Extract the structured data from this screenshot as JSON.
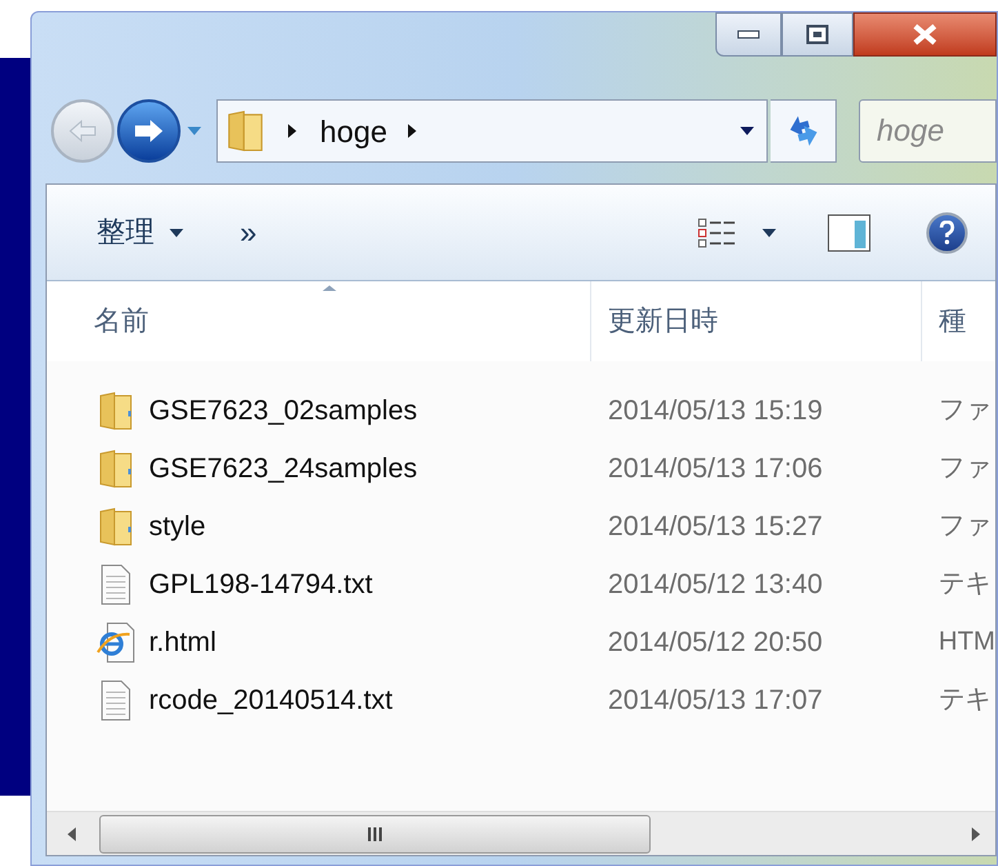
{
  "address_bar": {
    "crumbs": [
      "hoge"
    ]
  },
  "search": {
    "placeholder": "hoge"
  },
  "toolbar": {
    "organize": "整理",
    "more": "»"
  },
  "columns": [
    "名前",
    "更新日時",
    "種"
  ],
  "rows": [
    {
      "kind": "folder",
      "name": "GSE7623_02samples",
      "modified": "2014/05/13 15:19",
      "type": "ファ"
    },
    {
      "kind": "folder",
      "name": "GSE7623_24samples",
      "modified": "2014/05/13 17:06",
      "type": "ファ"
    },
    {
      "kind": "folder",
      "name": "style",
      "modified": "2014/05/13 15:27",
      "type": "ファ"
    },
    {
      "kind": "text",
      "name": "GPL198-14794.txt",
      "modified": "2014/05/12 13:40",
      "type": "テキ"
    },
    {
      "kind": "html",
      "name": "r.html",
      "modified": "2014/05/12 20:50",
      "type": "HTM"
    },
    {
      "kind": "text",
      "name": "rcode_20140514.txt",
      "modified": "2014/05/13 17:07",
      "type": "テキ"
    }
  ]
}
